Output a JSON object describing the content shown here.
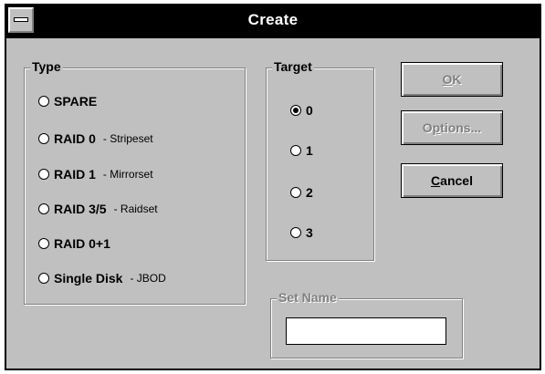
{
  "window": {
    "title": "Create"
  },
  "type_group": {
    "label": "Type",
    "options": [
      {
        "label": "SPARE",
        "note": "",
        "checked": false
      },
      {
        "label": "RAID 0",
        "note": "- Stripeset",
        "checked": false
      },
      {
        "label": "RAID 1",
        "note": "- Mirrorset",
        "checked": false
      },
      {
        "label": "RAID 3/5",
        "note": "- Raidset",
        "checked": false
      },
      {
        "label": "RAID 0+1",
        "note": "",
        "checked": false
      },
      {
        "label": "Single Disk",
        "note": "- JBOD",
        "checked": false
      }
    ]
  },
  "target_group": {
    "label": "Target",
    "options": [
      {
        "label": "0",
        "checked": true
      },
      {
        "label": "1",
        "checked": false
      },
      {
        "label": "2",
        "checked": false
      },
      {
        "label": "3",
        "checked": false
      }
    ]
  },
  "setname_group": {
    "label": "Set Name",
    "value": "",
    "disabled": true
  },
  "buttons": {
    "ok": {
      "mnemonic": "O",
      "rest": "K",
      "disabled": true
    },
    "options": {
      "pre": "O",
      "mnemonic": "p",
      "rest": "tions...",
      "disabled": true
    },
    "cancel": {
      "mnemonic": "C",
      "rest": "ancel",
      "disabled": false
    }
  }
}
